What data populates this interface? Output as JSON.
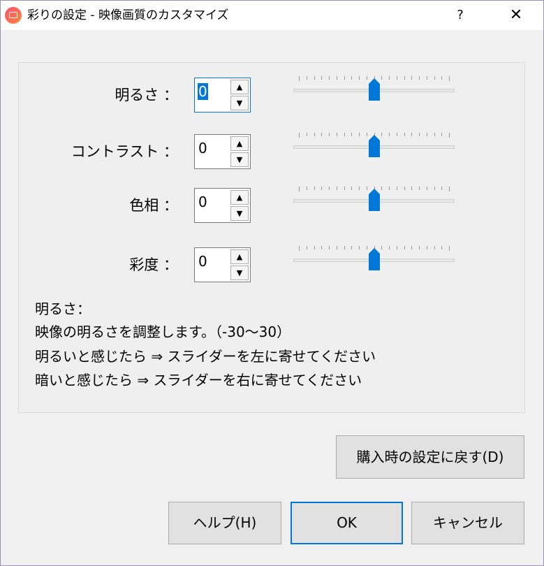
{
  "window": {
    "title": "彩りの設定 - 映像画質のカスタマイズ",
    "help_label": "?",
    "close_label": "✕"
  },
  "settings": [
    {
      "label": "明るさ ：",
      "value": "0",
      "slider_fraction": 0.5,
      "focused": true
    },
    {
      "label": "コントラスト ：",
      "value": "0",
      "slider_fraction": 0.5,
      "focused": false
    },
    {
      "label": "色相 ：",
      "value": "0",
      "slider_fraction": 0.5,
      "focused": false
    },
    {
      "label": "彩度 ：",
      "value": "0",
      "slider_fraction": 0.5,
      "focused": false
    }
  ],
  "spin_up_glyph": "▲",
  "spin_down_glyph": "▼",
  "description": {
    "lines": [
      "明るさ：",
      "映像の明るさを調整します。（-30～30）",
      "明るいと感じたら ⇒ スライダーを左に寄せてください",
      "暗いと感じたら ⇒ スライダーを右に寄せてください"
    ]
  },
  "buttons": {
    "reset": "購入時の設定に戻す(D)",
    "help": "ヘルプ(H)",
    "ok": "OK",
    "cancel": "キャンセル"
  },
  "colors": {
    "accent": "#0078d7",
    "slider_thumb": "#0078d7",
    "background": "#f0f0f0"
  }
}
